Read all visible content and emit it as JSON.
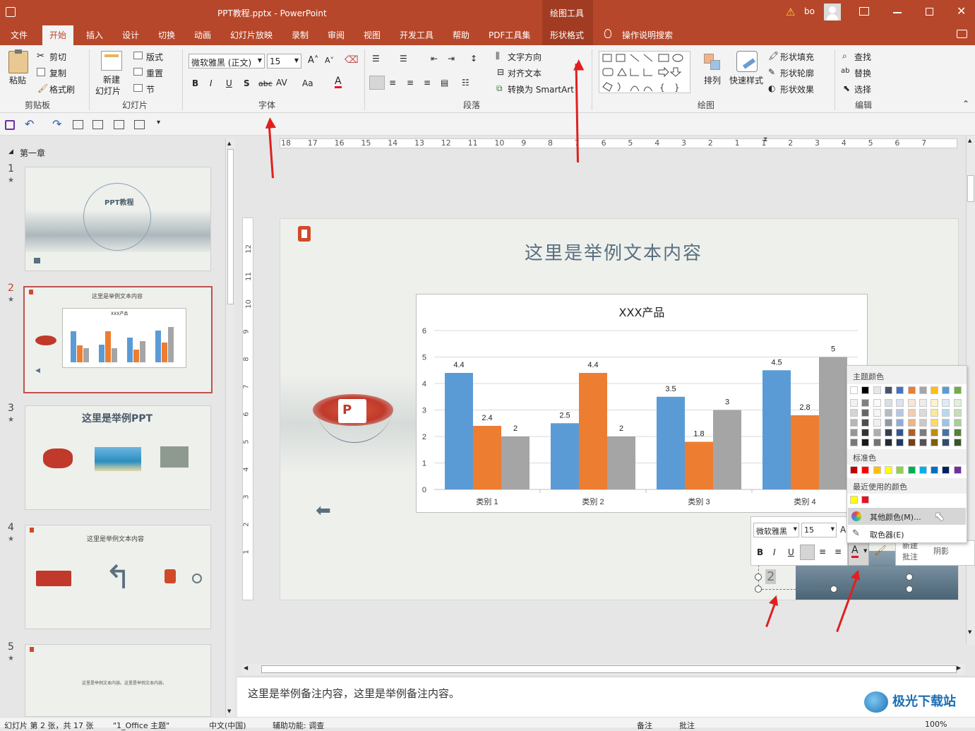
{
  "window": {
    "title": "PPT教程.pptx  -  PowerPoint",
    "context_tab_group": "绘图工具",
    "user": "bo"
  },
  "tabs": [
    "文件",
    "开始",
    "插入",
    "设计",
    "切换",
    "动画",
    "幻灯片放映",
    "录制",
    "审阅",
    "视图",
    "开发工具",
    "帮助",
    "PDF工具集",
    "形状格式"
  ],
  "active_tab": "开始",
  "tell_me": "操作说明搜索",
  "ribbon": {
    "clipboard": {
      "paste": "粘贴",
      "cut": "剪切",
      "copy": "复制",
      "format_painter": "格式刷",
      "label": "剪贴板"
    },
    "slides": {
      "new_slide_1": "新建",
      "new_slide_2": "幻灯片",
      "layout": "版式",
      "reset": "重置",
      "section": "节",
      "label": "幻灯片"
    },
    "font": {
      "font_name": "微软雅黑 (正文)",
      "font_size": "15",
      "label": "字体"
    },
    "paragraph": {
      "text_direction": "文字方向",
      "align_text": "对齐文本",
      "convert_smartart": "转换为 SmartArt",
      "label": "段落"
    },
    "drawing": {
      "arrange": "排列",
      "quick_styles": "快速样式",
      "shape_fill": "形状填充",
      "shape_outline": "形状轮廓",
      "shape_effects": "形状效果",
      "label": "绘图"
    },
    "editing": {
      "find": "查找",
      "replace": "替换",
      "select": "选择",
      "label": "编辑"
    }
  },
  "ruler": {
    "h_ticks": [
      "18",
      "17",
      "16",
      "15",
      "14",
      "13",
      "12",
      "11",
      "10",
      "9",
      "8",
      "7",
      "6",
      "5",
      "4",
      "3",
      "2",
      "1",
      "1",
      "2",
      "3",
      "4",
      "5",
      "6",
      "7"
    ],
    "v_ticks": [
      "12",
      "11",
      "10",
      "9",
      "8",
      "7",
      "6",
      "5",
      "4",
      "3",
      "2",
      "1"
    ]
  },
  "slides_pane": {
    "section": "第一章",
    "slides": [
      {
        "num": "1",
        "title": "PPT教程"
      },
      {
        "num": "2",
        "title": "这里是举例文本内容",
        "chart_title": "XXX产品"
      },
      {
        "num": "3",
        "title": "这里是举例PPT"
      },
      {
        "num": "4",
        "title": "这里是举例文本内容"
      },
      {
        "num": "5",
        "title": "这里是举例文本内容。这里是举例文本内容。"
      }
    ]
  },
  "slide": {
    "title": "这里是举例文本内容",
    "page_number": "2"
  },
  "chart_data": {
    "type": "bar",
    "title": "XXX产品",
    "categories": [
      "类别 1",
      "类别 2",
      "类别 3",
      "类别 4"
    ],
    "series": [
      {
        "values": [
          4.4,
          2.5,
          3.5,
          4.5
        ],
        "color": "#5b9bd5"
      },
      {
        "values": [
          2.4,
          4.4,
          1.8,
          2.8
        ],
        "color": "#ed7d31"
      },
      {
        "values": [
          2,
          2,
          3,
          5
        ],
        "color": "#a5a5a5"
      }
    ],
    "ylim": [
      0,
      6
    ],
    "yticks": [
      "0",
      "1",
      "2",
      "3",
      "4",
      "5",
      "6"
    ],
    "grid": true
  },
  "color_panel": {
    "theme_header": "主题颜色",
    "standard_header": "标准色",
    "recent_header": "最近使用的颜色",
    "more_colors": "其他颜色(M)...",
    "eyedropper": "取色器(E)",
    "theme_colors": [
      "#ffffff",
      "#000000",
      "#e7e6e6",
      "#44546a",
      "#4472c4",
      "#ed7d31",
      "#a5a5a5",
      "#ffc000",
      "#5b9bd5",
      "#70ad47"
    ],
    "standard_colors": [
      "#c00000",
      "#ff0000",
      "#ffc000",
      "#ffff00",
      "#92d050",
      "#00b050",
      "#00b0f0",
      "#0070c0",
      "#002060",
      "#7030a0"
    ],
    "recent_colors": [
      "#ffff00",
      "#e81123"
    ]
  },
  "mini_toolbar": {
    "font": "微软雅黑",
    "size": "15",
    "new_comment_1": "新建",
    "new_comment_2": "批注",
    "shadow": "阴影"
  },
  "notes": "这里是举例备注内容，这里是举例备注内容。",
  "status": {
    "slide_info": "幻灯片 第 2 张，共 17 张",
    "theme": "\"1_Office 主题\"",
    "language": "中文(中国)",
    "accessibility": "辅助功能: 调查",
    "notes_btn": "备注",
    "comments_btn": "批注",
    "zoom": "100%"
  },
  "watermark": "极光下载站",
  "accent": "#b7472a"
}
